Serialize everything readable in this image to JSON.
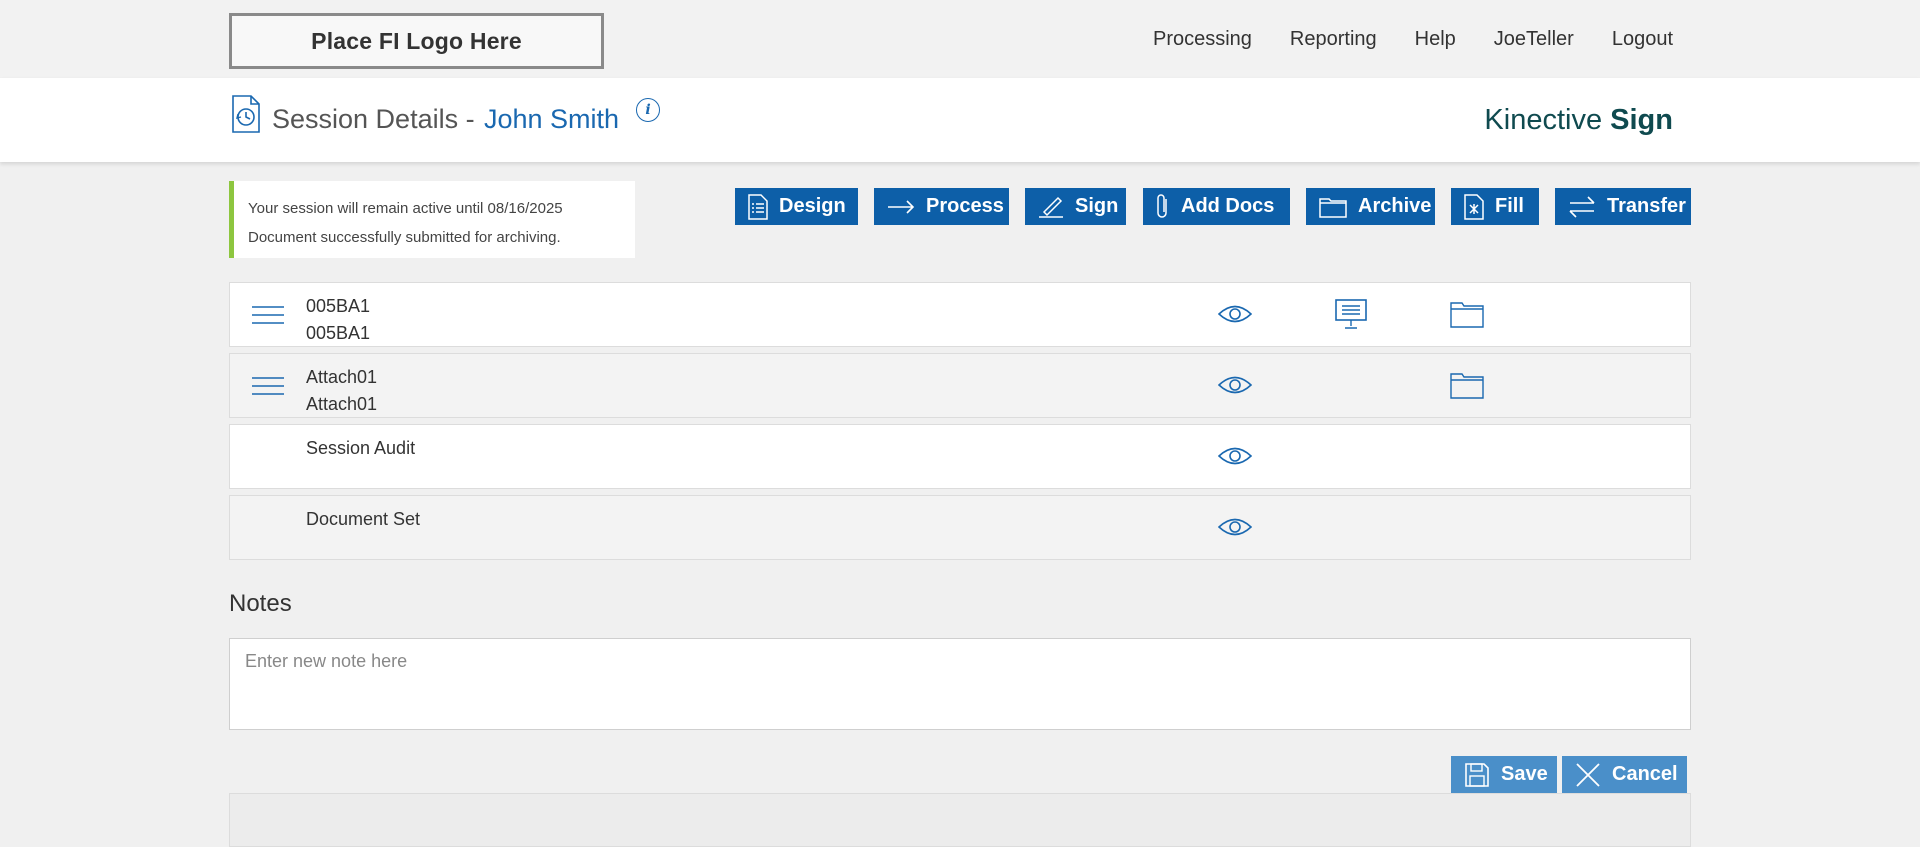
{
  "nav": {
    "logo": "Place FI Logo Here",
    "links": [
      "Processing",
      "Reporting",
      "Help",
      "JoeTeller",
      "Logout"
    ]
  },
  "header": {
    "title": "Session Details -",
    "customer_name": "John Smith",
    "info_icon": "i",
    "brand_light": "Kinective",
    "brand_bold": "Sign"
  },
  "status": {
    "line1": "Your session will remain active until 08/16/2025",
    "line2": "Document successfully submitted for archiving.",
    "accent_color": "#8dc63f"
  },
  "actions": {
    "design": "Design",
    "process": "Process",
    "sign": "Sign",
    "add_docs": "Add Docs",
    "archive": "Archive",
    "fill": "Fill",
    "transfer": "Transfer",
    "color": "#0d5fa8"
  },
  "documents": [
    {
      "line1": "005BA1",
      "line2": "005BA1",
      "icons": [
        "eye-icon",
        "monitor-icon",
        "folder-icon"
      ]
    },
    {
      "line1": "Attach01",
      "line2": "Attach01",
      "icons": [
        "eye-icon",
        "folder-icon"
      ]
    },
    {
      "line1": "Session Audit",
      "line2": "",
      "icons": [
        "eye-icon"
      ]
    },
    {
      "line1": "Document Set",
      "line2": "",
      "icons": [
        "eye-icon"
      ]
    }
  ],
  "notes": {
    "heading": "Notes",
    "placeholder": "Enter new note here",
    "save": "Save",
    "cancel": "Cancel"
  }
}
